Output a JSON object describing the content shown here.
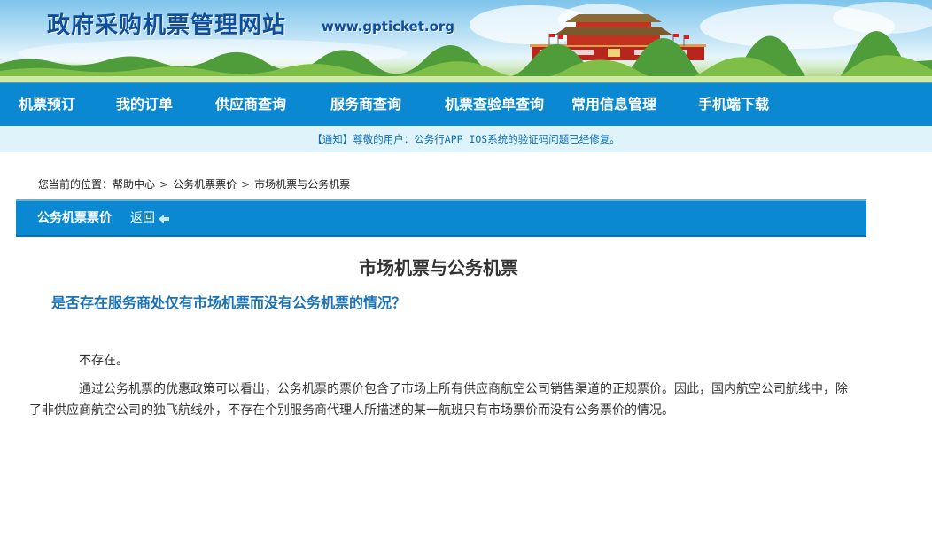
{
  "header": {
    "site_title": "政府采购机票管理网站",
    "site_url": "www.gpticket.org"
  },
  "nav": {
    "items": [
      {
        "label": "机票预订"
      },
      {
        "label": "我的订单"
      },
      {
        "label": "供应商查询"
      },
      {
        "label": "服务商查询"
      },
      {
        "label": "机票查验单查询"
      },
      {
        "label": "常用信息管理"
      },
      {
        "label": "手机端下载"
      }
    ]
  },
  "notice": {
    "text": "【通知】尊敬的用户：公务行APP IOS系统的验证码问题已经修复。"
  },
  "breadcrumb": {
    "prefix": "您当前的位置：",
    "items": [
      {
        "label": "帮助中心"
      },
      {
        "label": "公务机票票价"
      },
      {
        "label": "市场机票与公务机票"
      }
    ],
    "separator": ">"
  },
  "section": {
    "title": "公务机票票价",
    "back_label": "返回"
  },
  "article": {
    "title": "市场机票与公务机票",
    "question": "是否存在服务商处仅有市场机票而没有公务机票的情况？",
    "answer_short": "不存在。",
    "answer_body": "通过公务机票的优惠政策可以看出，公务机票的票价包含了市场上所有供应商航空公司销售渠道的正规票价。因此，国内航空公司航线中，除了非供应商航空公司的独飞航线外，不存在个别服务商代理人所描述的某一航班只有市场票价而没有公务票价的情况。"
  },
  "colors": {
    "nav_bg": "#0a88d1",
    "notice_bg": "#dff3fa",
    "notice_text": "#0c6fb8",
    "question_text": "#1a72b5",
    "title_text": "#0f4f9a"
  }
}
